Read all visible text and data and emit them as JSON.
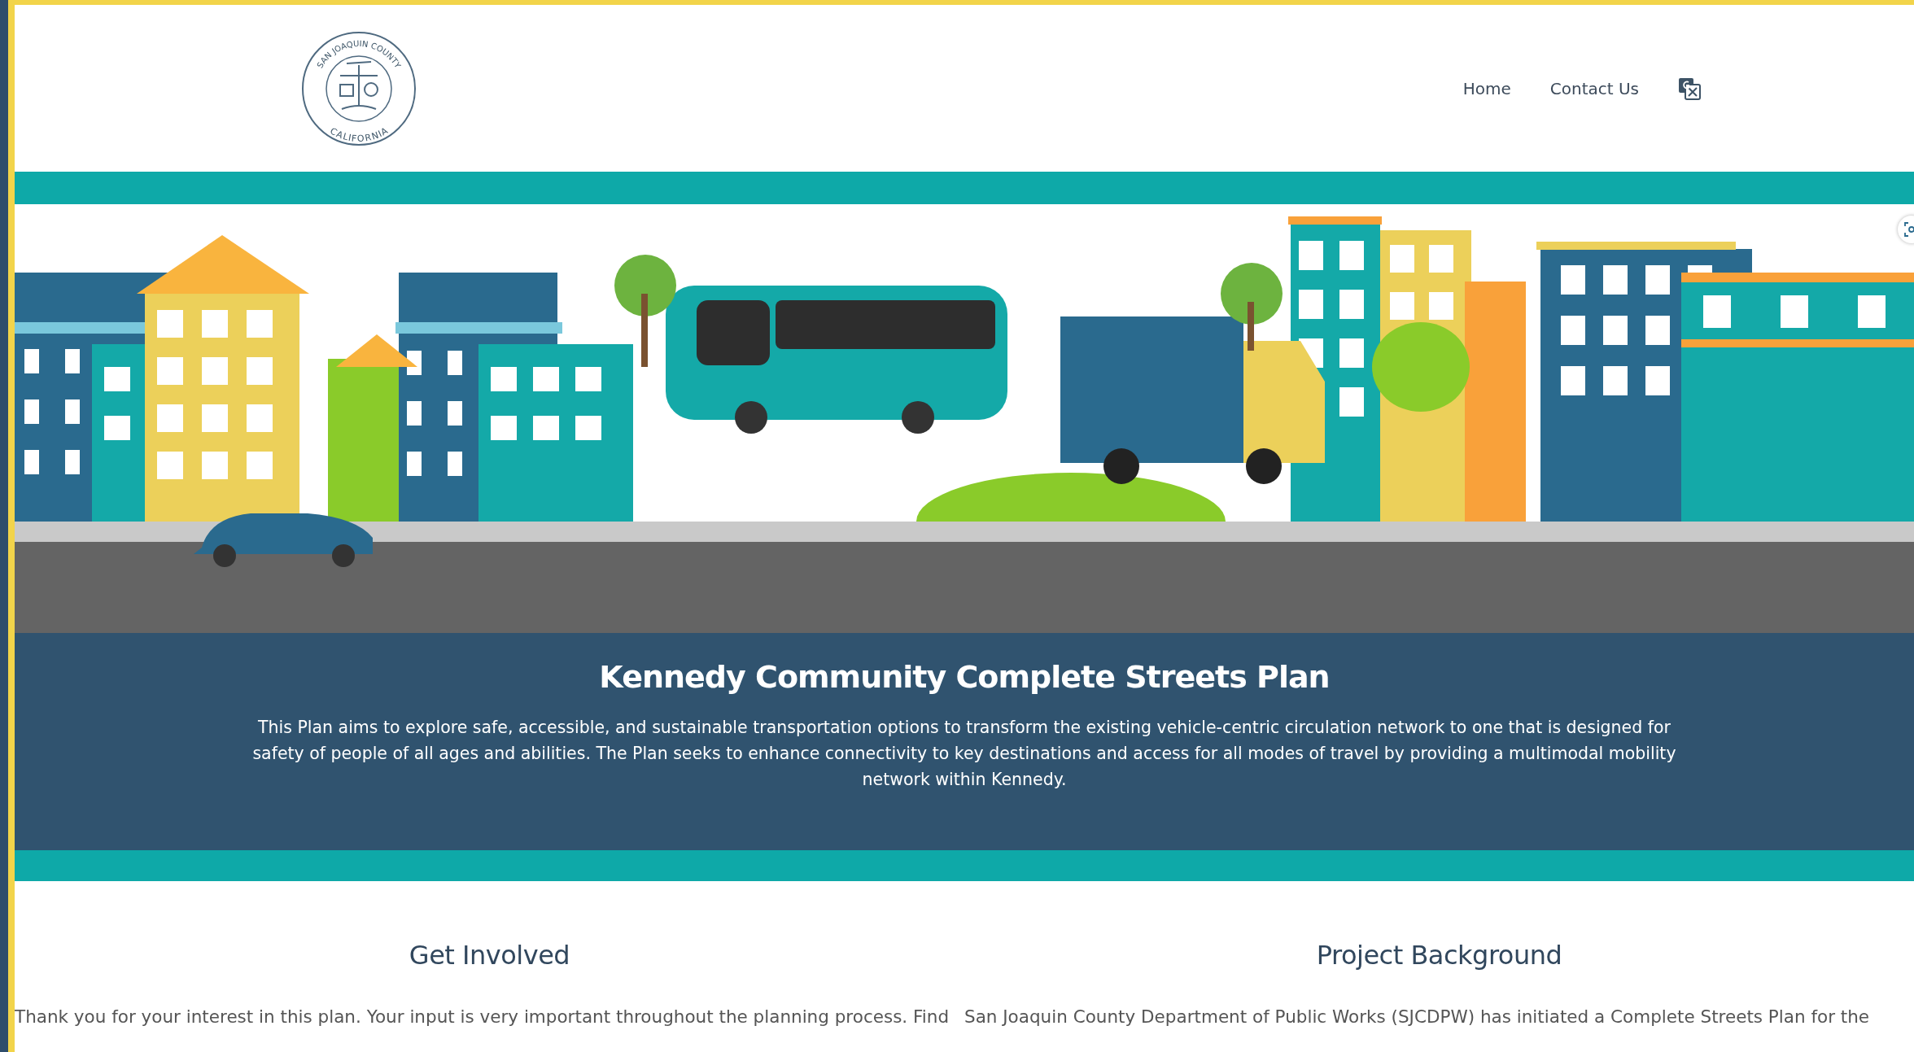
{
  "header": {
    "logo": {
      "top_text": "SAN JOAQUIN COUNTY",
      "bottom_text": "CALIFORNIA"
    },
    "nav": [
      {
        "label": "Home"
      },
      {
        "label": "Contact Us"
      }
    ]
  },
  "hero": {
    "title": "Kennedy Community Complete Streets  Plan",
    "description": "This Plan aims to explore safe, accessible, and sustainable transportation options to transform the existing vehicle-centric circulation network to one that is designed for safety of people of all ages and abilities. The Plan seeks to enhance connectivity to key destinations and access for all modes of travel by providing a multimodal mobility network within Kennedy."
  },
  "sections": [
    {
      "heading": "Get Involved",
      "text": "Thank you for your interest in this plan. Your input is very important throughout the planning process. Find"
    },
    {
      "heading": "Project Background",
      "text": "San Joaquin County Department of Public Works (SJCDPW) has initiated a Complete Streets Plan for the"
    }
  ]
}
